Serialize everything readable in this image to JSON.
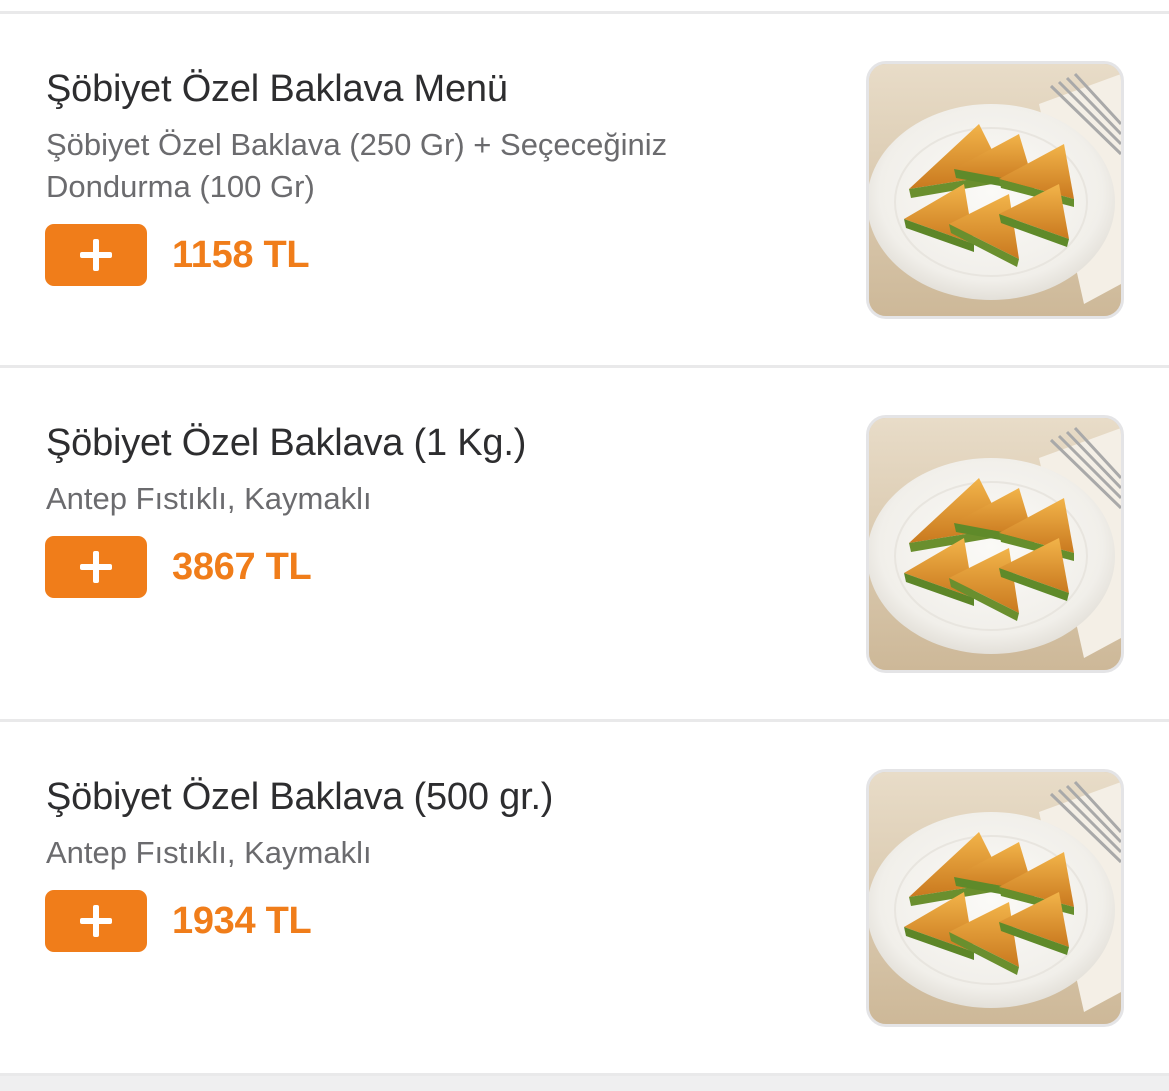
{
  "menu": {
    "items": [
      {
        "name": "Şöbiyet Özel Baklava Menü",
        "description": "Şöbiyet Özel Baklava (250 Gr) + Seçeceğiniz Dondurma (100 Gr)",
        "price": "1158 TL",
        "add_label": "+",
        "image_icon": "baklava-plate-image"
      },
      {
        "name": "Şöbiyet Özel Baklava (1 Kg.)",
        "description": "Antep Fıstıklı, Kaymaklı",
        "price": "3867 TL",
        "add_label": "+",
        "image_icon": "baklava-plate-image"
      },
      {
        "name": "Şöbiyet Özel Baklava (500 gr.)",
        "description": "Antep Fıstıklı, Kaymaklı",
        "price": "1934 TL",
        "add_label": "+",
        "image_icon": "baklava-plate-image"
      }
    ]
  },
  "colors": {
    "accent": "#f07d1a",
    "title_text": "#2d2d2f",
    "description_text": "#6b6b6e",
    "divider": "#e9e9ea"
  }
}
